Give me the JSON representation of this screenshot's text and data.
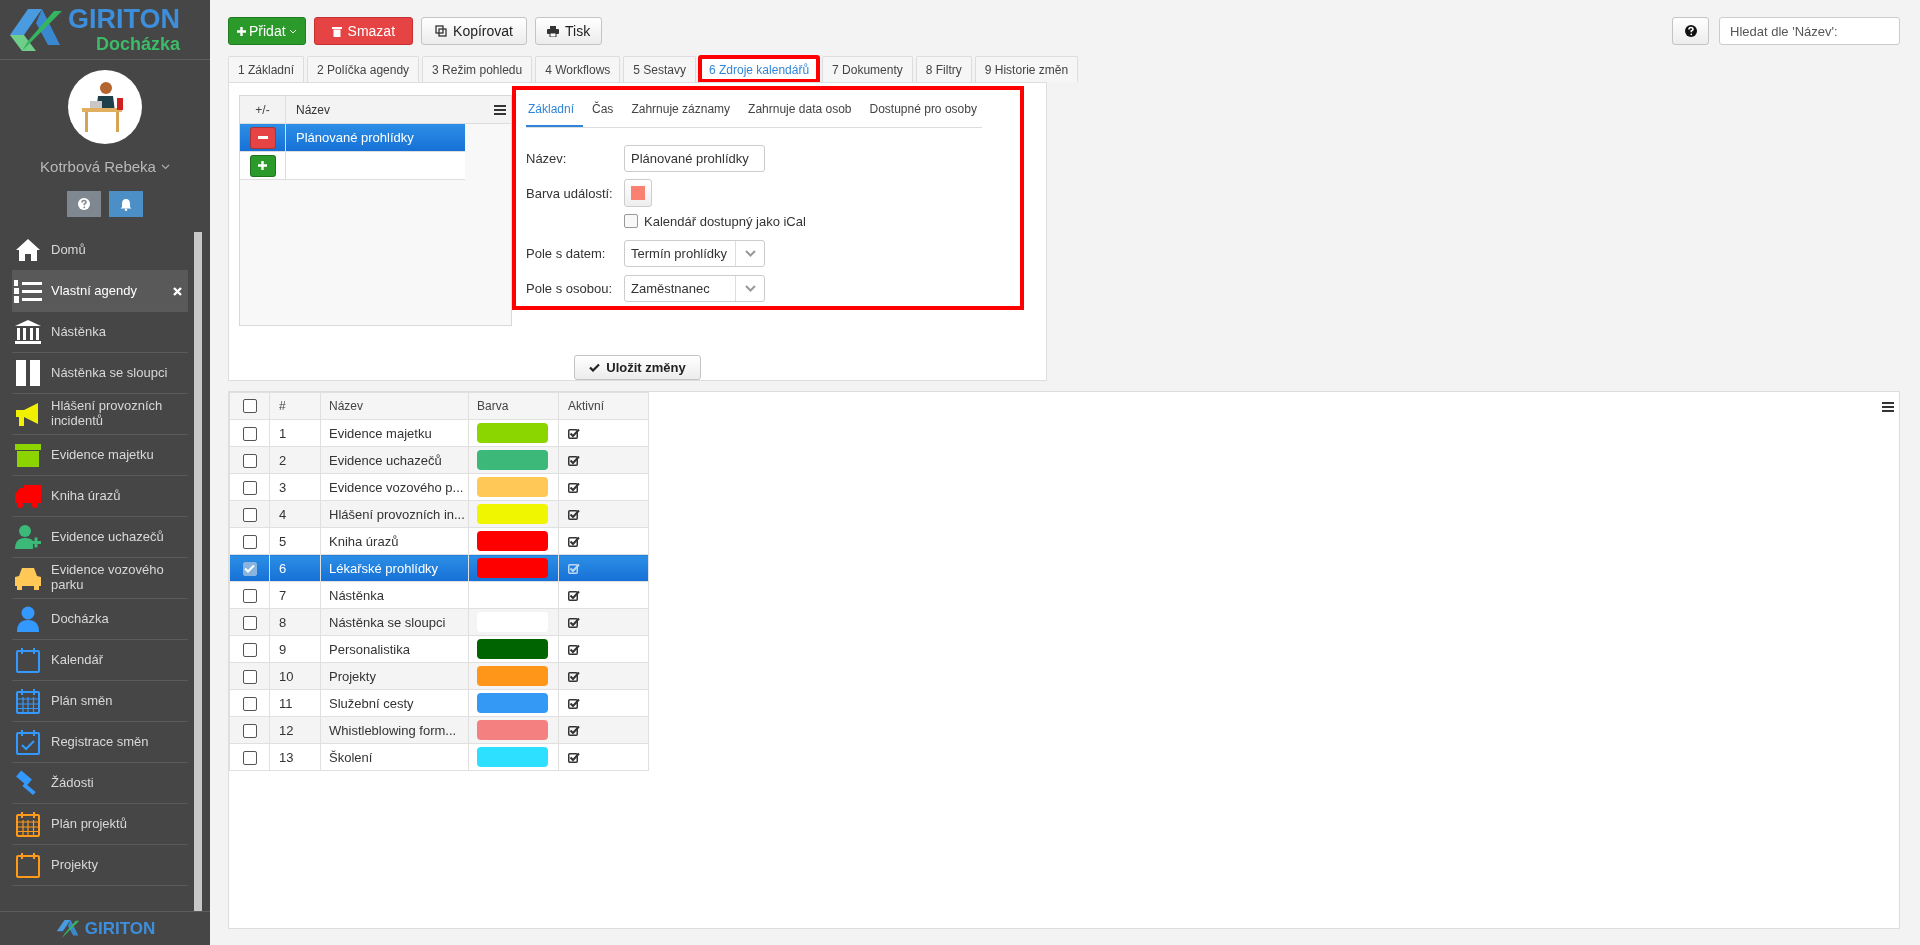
{
  "brand": {
    "name": "GIRITON",
    "product": "Docházka"
  },
  "user": {
    "name": "Kotrbová Rebeka"
  },
  "sidebar": {
    "items": [
      {
        "label": "Domů",
        "color": "#ffffff",
        "selected": false
      },
      {
        "label": "Vlastní agendy",
        "color": "#ffffff",
        "selected": true
      },
      {
        "label": "Nástěnka",
        "color": "#ffffff",
        "selected": false
      },
      {
        "label": "Nástěnka se sloupci",
        "color": "#ffffff",
        "selected": false
      },
      {
        "label": "Hlášení provozních incidentů",
        "color": "#f0f000",
        "selected": false
      },
      {
        "label": "Evidence majetku",
        "color": "#8cd400",
        "selected": false
      },
      {
        "label": "Kniha úrazů",
        "color": "#ff0000",
        "selected": false
      },
      {
        "label": "Evidence uchazečů",
        "color": "#3cb878",
        "selected": false
      },
      {
        "label": "Evidence vozového parku",
        "color": "#ffc857",
        "selected": false
      },
      {
        "label": "Docházka",
        "color": "#3399ff",
        "selected": false
      },
      {
        "label": "Kalendář",
        "color": "#3399ff",
        "selected": false
      },
      {
        "label": "Plán směn",
        "color": "#3399ff",
        "selected": false
      },
      {
        "label": "Registrace směn",
        "color": "#3399ff",
        "selected": false
      },
      {
        "label": "Žádosti",
        "color": "#3399ff",
        "selected": false
      },
      {
        "label": "Plán projektů",
        "color": "#ff9a1a",
        "selected": false
      },
      {
        "label": "Projekty",
        "color": "#ff9a1a",
        "selected": false
      }
    ]
  },
  "footer_brand": "GIRITON",
  "toolbar": [
    {
      "label": "Přidat",
      "kind": "add"
    },
    {
      "label": "Smazat",
      "kind": "delete"
    },
    {
      "label": "Kopírovat",
      "kind": "copy"
    },
    {
      "label": "Tisk",
      "kind": "print"
    }
  ],
  "search": {
    "placeholder": "Hledat dle 'Název':"
  },
  "tabs": [
    {
      "label": "1 Základní",
      "selected": false,
      "highlighted": false
    },
    {
      "label": "2 Políčka agendy",
      "selected": false,
      "highlighted": false
    },
    {
      "label": "3 Režim pohledu",
      "selected": false,
      "highlighted": false
    },
    {
      "label": "4 Workflows",
      "selected": false,
      "highlighted": false
    },
    {
      "label": "5 Sestavy",
      "selected": false,
      "highlighted": false
    },
    {
      "label": "6 Zdroje kalendářů",
      "selected": true,
      "highlighted": true
    },
    {
      "label": "7 Dokumenty",
      "selected": false,
      "highlighted": false
    },
    {
      "label": "8 Filtry",
      "selected": false,
      "highlighted": false
    },
    {
      "label": "9 Historie změn",
      "selected": false,
      "highlighted": false
    }
  ],
  "sources": {
    "columns": [
      "+/-",
      "Název"
    ],
    "rows": [
      {
        "kind": "remove",
        "name": "Plánované prohlídky",
        "selected": true
      },
      {
        "kind": "add",
        "selected": false
      }
    ]
  },
  "form": {
    "highlighted": true,
    "tabs": [
      {
        "label": "Základní",
        "selected": true
      },
      {
        "label": "Čas",
        "selected": false
      },
      {
        "label": "Zahrnuje záznamy",
        "selected": false
      },
      {
        "label": "Zahrnuje data osob",
        "selected": false
      },
      {
        "label": "Dostupné pro osoby",
        "selected": false
      }
    ],
    "fields": [
      {
        "kind": "text",
        "label": "Název:",
        "value": "Plánované prohlídky"
      },
      {
        "kind": "color",
        "label": "Barva událostí:",
        "color": "#fa8072"
      },
      {
        "kind": "checkbox",
        "label": "Kalendář dostupný jako iCal",
        "checked": false
      },
      {
        "kind": "select",
        "label": "Pole s datem:",
        "value": "Termín prohlídky"
      },
      {
        "kind": "select",
        "label": "Pole s osobou:",
        "value": "Zaměstnanec"
      }
    ]
  },
  "save_button": "Uložit změny",
  "table": {
    "all_selected": false,
    "columns": [
      "#",
      "Název",
      "Barva",
      "Aktivní"
    ],
    "rows": [
      {
        "number": "1",
        "name": "Evidence majetku",
        "color": "#8cd600",
        "active": true,
        "selected": false
      },
      {
        "number": "2",
        "name": "Evidence uchazečů",
        "color": "#3cb878",
        "active": true,
        "selected": false
      },
      {
        "number": "3",
        "name": "Evidence vozového p...",
        "color": "#ffc857",
        "active": true,
        "selected": false
      },
      {
        "number": "4",
        "name": "Hlášení provozních in...",
        "color": "#f0f500",
        "active": true,
        "selected": false
      },
      {
        "number": "5",
        "name": "Kniha úrazů",
        "color": "#ff0000",
        "active": true,
        "selected": false
      },
      {
        "number": "6",
        "name": "Lékařské prohlídky",
        "color": "#ff0000",
        "active": true,
        "selected": true
      },
      {
        "number": "7",
        "name": "Nástěnka",
        "active": true,
        "selected": false
      },
      {
        "number": "8",
        "name": "Nástěnka se sloupci",
        "color": "#ffffff",
        "active": true,
        "selected": false
      },
      {
        "number": "9",
        "name": "Personalistika",
        "color": "#006400",
        "active": true,
        "selected": false
      },
      {
        "number": "10",
        "name": "Projekty",
        "color": "#ff961a",
        "active": true,
        "selected": false
      },
      {
        "number": "11",
        "name": "Služební cesty",
        "color": "#3399f5",
        "active": true,
        "selected": false
      },
      {
        "number": "12",
        "name": "Whistleblowing form...",
        "color": "#f48080",
        "active": true,
        "selected": false
      },
      {
        "number": "13",
        "name": "Školení",
        "color": "#2ee0ff",
        "active": true,
        "selected": false
      }
    ]
  }
}
